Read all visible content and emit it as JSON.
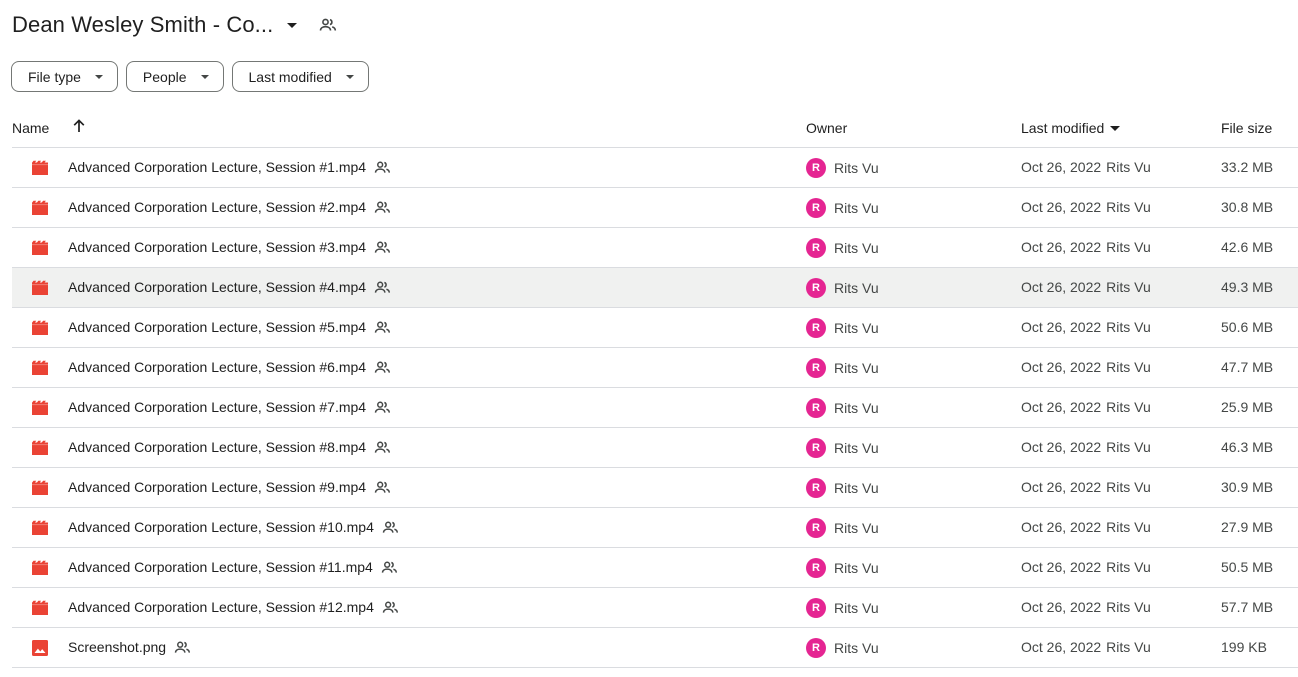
{
  "header": {
    "folder_title": "Dean Wesley Smith - Co...",
    "icons": {
      "caret": "caret-down-icon",
      "shared": "people-icon"
    }
  },
  "filters": {
    "file_type": "File type",
    "people": "People",
    "last_modified": "Last modified"
  },
  "table": {
    "columns": {
      "name": "Name",
      "owner": "Owner",
      "last_modified": "Last modified",
      "file_size": "File size"
    },
    "sort": {
      "name_direction": "ascending",
      "active_column": "Last modified"
    },
    "rows": [
      {
        "name": "Advanced Corporation Lecture, Session #1.mp4",
        "type": "video",
        "owner_initial": "R",
        "owner": "Rits Vu",
        "modified": "Oct 26, 2022",
        "modified_by": "Rits Vu",
        "size": "33.2 MB"
      },
      {
        "name": "Advanced Corporation Lecture, Session #2.mp4",
        "type": "video",
        "owner_initial": "R",
        "owner": "Rits Vu",
        "modified": "Oct 26, 2022",
        "modified_by": "Rits Vu",
        "size": "30.8 MB"
      },
      {
        "name": "Advanced Corporation Lecture, Session #3.mp4",
        "type": "video",
        "owner_initial": "R",
        "owner": "Rits Vu",
        "modified": "Oct 26, 2022",
        "modified_by": "Rits Vu",
        "size": "42.6 MB"
      },
      {
        "name": "Advanced Corporation Lecture, Session #4.mp4",
        "type": "video",
        "owner_initial": "R",
        "owner": "Rits Vu",
        "modified": "Oct 26, 2022",
        "modified_by": "Rits Vu",
        "size": "49.3 MB"
      },
      {
        "name": "Advanced Corporation Lecture, Session #5.mp4",
        "type": "video",
        "owner_initial": "R",
        "owner": "Rits Vu",
        "modified": "Oct 26, 2022",
        "modified_by": "Rits Vu",
        "size": "50.6 MB"
      },
      {
        "name": "Advanced Corporation Lecture, Session #6.mp4",
        "type": "video",
        "owner_initial": "R",
        "owner": "Rits Vu",
        "modified": "Oct 26, 2022",
        "modified_by": "Rits Vu",
        "size": "47.7 MB"
      },
      {
        "name": "Advanced Corporation Lecture, Session #7.mp4",
        "type": "video",
        "owner_initial": "R",
        "owner": "Rits Vu",
        "modified": "Oct 26, 2022",
        "modified_by": "Rits Vu",
        "size": "25.9 MB"
      },
      {
        "name": "Advanced Corporation Lecture, Session #8.mp4",
        "type": "video",
        "owner_initial": "R",
        "owner": "Rits Vu",
        "modified": "Oct 26, 2022",
        "modified_by": "Rits Vu",
        "size": "46.3 MB"
      },
      {
        "name": "Advanced Corporation Lecture, Session #9.mp4",
        "type": "video",
        "owner_initial": "R",
        "owner": "Rits Vu",
        "modified": "Oct 26, 2022",
        "modified_by": "Rits Vu",
        "size": "30.9 MB"
      },
      {
        "name": "Advanced Corporation Lecture, Session #10.mp4",
        "type": "video",
        "owner_initial": "R",
        "owner": "Rits Vu",
        "modified": "Oct 26, 2022",
        "modified_by": "Rits Vu",
        "size": "27.9 MB"
      },
      {
        "name": "Advanced Corporation Lecture, Session #11.mp4",
        "type": "video",
        "owner_initial": "R",
        "owner": "Rits Vu",
        "modified": "Oct 26, 2022",
        "modified_by": "Rits Vu",
        "size": "50.5 MB"
      },
      {
        "name": "Advanced Corporation Lecture, Session #12.mp4",
        "type": "video",
        "owner_initial": "R",
        "owner": "Rits Vu",
        "modified": "Oct 26, 2022",
        "modified_by": "Rits Vu",
        "size": "57.7 MB"
      },
      {
        "name": "Screenshot.png",
        "type": "image",
        "owner_initial": "R",
        "owner": "Rits Vu",
        "modified": "Oct 26, 2022",
        "modified_by": "Rits Vu",
        "size": "199 KB"
      }
    ],
    "hovered_row": 3
  },
  "colors": {
    "video_icon": "#ea4335",
    "image_icon": "#ea4335",
    "avatar": "#e52592",
    "hover_row": "#f0f1f0",
    "divider": "#dadce0"
  }
}
